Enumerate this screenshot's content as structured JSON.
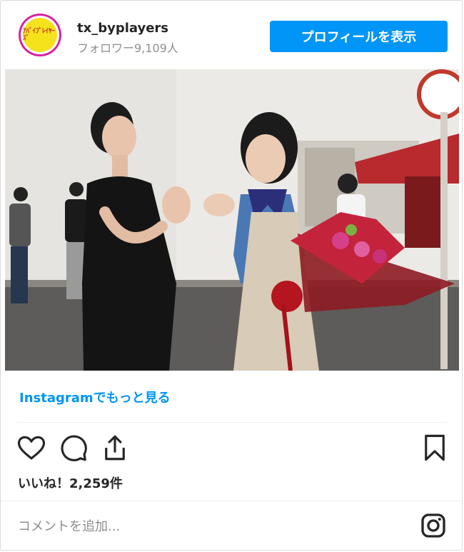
{
  "header": {
    "avatar_text_top": "ｱﾊﾞｲﾌﾟﾚｲﾔｰｽﾞ",
    "avatar_text_bottom": "",
    "username": "tx_byplayers",
    "followers": "フォロワー9,109人",
    "profile_button": "プロフィールを表示"
  },
  "post": {
    "image_icon": "photo-two-women-bouquet",
    "view_more": "Instagramでもっと見る"
  },
  "actions": {
    "like_icon": "heart-icon",
    "comment_icon": "comment-icon",
    "share_icon": "share-icon",
    "save_icon": "bookmark-icon"
  },
  "likes": {
    "text": "いいね！2,259件"
  },
  "comment": {
    "placeholder": "コメントを追加..."
  },
  "colors": {
    "accent": "#0095f6",
    "text": "#262626",
    "muted": "#8e8e8e"
  }
}
